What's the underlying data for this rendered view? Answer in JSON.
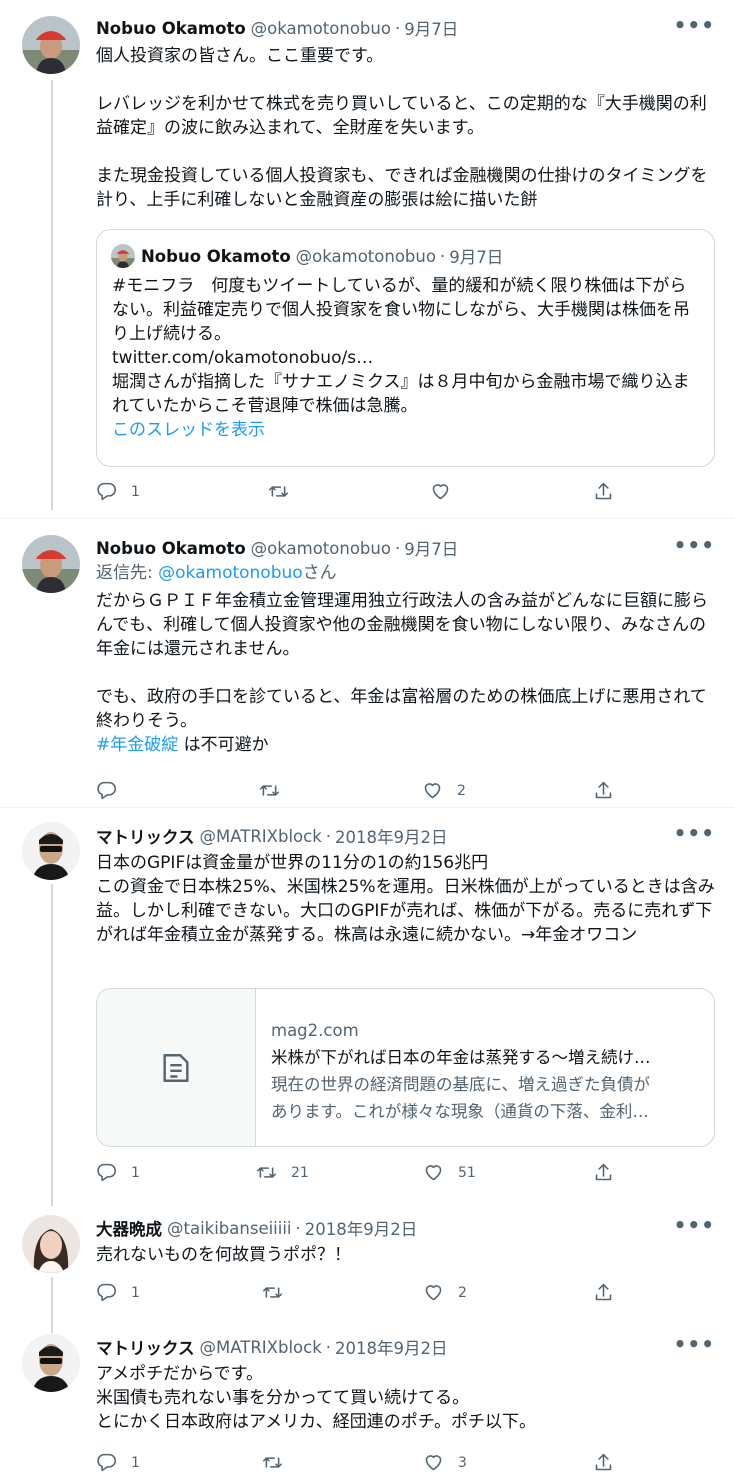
{
  "tweets": [
    {
      "name": "Nobuo Okamoto",
      "handle": "@okamotonobuo",
      "date": "9月7日",
      "text": "個人投資家の皆さん。ここ重要です。\n\nレバレッジを利かせて株式を売り買いしていると、この定期的な『大手機関の利益確定』の波に飲み込まれて、全財産を失います。\n\nまた現金投資している個人投資家も、できれば金融機関の仕掛けのタイミングを計り、上手に利確しないと金融資産の膨張は絵に描いた餅",
      "reply_count": "1",
      "retweet_count": "",
      "like_count": ""
    },
    {
      "name": "Nobuo Okamoto",
      "handle": "@okamotonobuo",
      "date": "9月7日",
      "reply_prefix": "返信先: ",
      "reply_handle": "@okamotonobuo",
      "reply_suffix": "さん",
      "text": "だからＧＰＩＦ年金積立金管理運用独立行政法人の含み益がどんなに巨額に膨らんでも、利確して個人投資家や他の金融機関を食い物にしない限り、みなさんの年金には還元されません。\n\nでも、政府の手口を診ていると、年金は富裕層のための株価底上げに悪用されて終わりそう。",
      "hashtag": "#年金破綻",
      "hashtag_suffix": " は不可避か",
      "reply_count": "",
      "retweet_count": "",
      "like_count": "2"
    },
    {
      "name": "マトリックス",
      "handle": "@MATRIXblock",
      "date": "2018年9月2日",
      "text": "日本のGPIFは資金量が世界の11分の1の約156兆円\nこの資金で日本株25%、米国株25%を運用。日米株価が上がっているときは含み益。しかし利確できない。大口のGPIFが売れば、株価が下がる。売るに売れず下がれば年金積立金が蒸発する。株高は永遠に続かない。→年金オワコン",
      "reply_count": "1",
      "retweet_count": "21",
      "like_count": "51"
    },
    {
      "name": "大器晩成",
      "handle": "@taikibanseiiiii",
      "date": "2018年9月2日",
      "text": "売れないものを何故買うポポ？！",
      "reply_count": "1",
      "retweet_count": "",
      "like_count": "2"
    },
    {
      "name": "マトリックス",
      "handle": "@MATRIXblock",
      "date": "2018年9月2日",
      "text": "アメポチだからです。\n米国債も売れない事を分かってて買い続けてる。\nとにかく日本政府はアメリカ、経団連のポチ。ポチ以下。",
      "reply_count": "1",
      "retweet_count": "",
      "like_count": "3"
    }
  ],
  "quote": {
    "name": "Nobuo Okamoto",
    "handle": "@okamotonobuo",
    "date": "9月7日",
    "text": "#モニフラ　何度もツイートしているが、量的緩和が続く限り株価は下がらない。利益確定売りで個人投資家を食い物にしながら、大手機関は株価を吊り上げ続ける。\ntwitter.com/okamotonobuo/s…\n堀潤さんが指摘した『サナエノミクス』は８月中旬から金融市場で織り込まれていたからこそ菅退陣で株価は急騰。",
    "show_thread": "このスレッドを表示"
  },
  "link_card": {
    "domain": "mag2.com",
    "title": "米株が下がれば日本の年金は蒸発する～増え続け…",
    "description_line1": "現在の世界の経済問題の基底に、増え過ぎた負債が",
    "description_line2": "あります。これが様々な現象（通貨の下落、金利…"
  },
  "dot": "·",
  "icons": {
    "reply": "reply-icon",
    "retweet": "retweet-icon",
    "like": "heart-icon",
    "share": "share-icon",
    "more": "more-icon",
    "card": "article-icon"
  },
  "colors": {
    "link": "#1d9bf0",
    "secondary": "#536471",
    "border": "#cfd9de"
  }
}
